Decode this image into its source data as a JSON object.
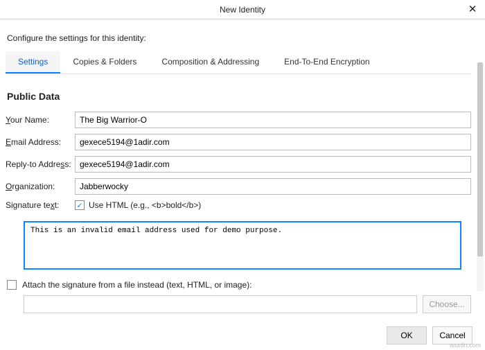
{
  "window": {
    "title": "New Identity",
    "subtitle": "Configure the settings for this identity:"
  },
  "tabs": {
    "settings": "Settings",
    "copies": "Copies & Folders",
    "composition": "Composition & Addressing",
    "encryption": "End-To-End Encryption"
  },
  "section": {
    "public_data": "Public Data"
  },
  "labels": {
    "your_name_u": "Y",
    "your_name_rest": "our Name:",
    "email_u": "E",
    "email_rest": "mail Address:",
    "reply_pre": "Reply-to Addre",
    "reply_u": "s",
    "reply_post": "s:",
    "org_u": "O",
    "org_rest": "rganization:",
    "sig_pre": "Signature te",
    "sig_u": "x",
    "sig_post": "t:",
    "use_html": "Use HTML (e.g., <b>bold</b>)",
    "attach": "Attach the signature from a file instead (text, HTML, or image):",
    "choose": "Choose..."
  },
  "values": {
    "your_name": "The Big Warrior-O",
    "email": "gexece5194@1adir.com",
    "reply_to": "gexece5194@1adir.com",
    "organization": "Jabberwocky",
    "use_html_checked": true,
    "signature": "This is an invalid email address used for demo purpose.",
    "attach_checked": false
  },
  "buttons": {
    "ok": "OK",
    "cancel": "Cancel"
  },
  "watermark": "wsxdn.com"
}
